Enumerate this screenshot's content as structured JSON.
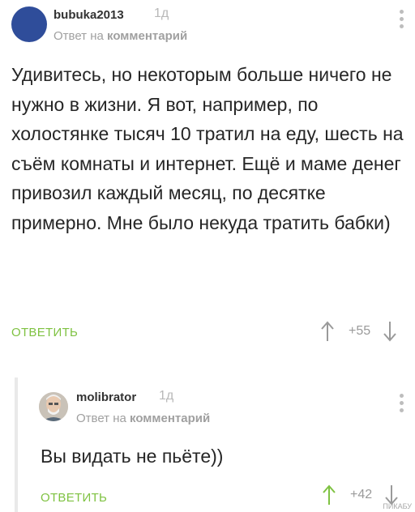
{
  "comment": {
    "username": "bubuka2013",
    "time": "1д",
    "sub_prefix": "Ответ на",
    "sub_bold": "комментарий",
    "text": "Удивитесь, но некоторым больше ничего не нужно в жизни. Я вот, например, по холостянке тысяч 10 тратил на еду, шесть на съём комнаты и интернет. Ещё и маме денег привозил каждый месяц, по десятке примерно. Мне было некуда тратить бабки)",
    "answer_label": "ОТВЕТИТЬ",
    "votes": "+55"
  },
  "reply": {
    "username": "molibrator",
    "time": "1д",
    "sub_prefix": "Ответ на",
    "sub_bold": "комментарий",
    "text": "Вы видать не пьёте))",
    "answer_label": "ОТВЕТИТЬ",
    "votes": "+42"
  },
  "colors": {
    "answer_green": "#7fc242",
    "avatar_blue": "#2f4d9a",
    "meta_gray": "#a0a0a0"
  },
  "icons": [
    "avatar",
    "more-vertical-icon",
    "arrow-up-icon",
    "arrow-down-icon"
  ],
  "watermark": "ПИКАБУ"
}
